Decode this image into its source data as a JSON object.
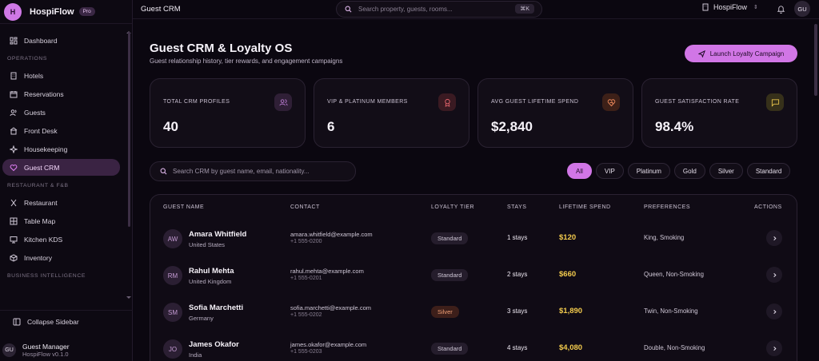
{
  "brand": {
    "logo_letter": "H",
    "name": "HospiFlow",
    "badge": "Pro"
  },
  "sidebar": {
    "top_items": [
      {
        "label": "Dashboard",
        "icon": "dashboard-icon"
      }
    ],
    "sections": [
      {
        "label": "OPERATIONS",
        "items": [
          {
            "label": "Hotels",
            "icon": "building-icon"
          },
          {
            "label": "Reservations",
            "icon": "calendar-icon"
          },
          {
            "label": "Guests",
            "icon": "users-icon"
          },
          {
            "label": "Front Desk",
            "icon": "bell-desk-icon"
          },
          {
            "label": "Housekeeping",
            "icon": "sparkle-icon"
          },
          {
            "label": "Guest CRM",
            "icon": "heart-icon",
            "active": true
          }
        ]
      },
      {
        "label": "RESTAURANT & F&B",
        "items": [
          {
            "label": "Restaurant",
            "icon": "utensils-icon"
          },
          {
            "label": "Table Map",
            "icon": "grid-icon"
          },
          {
            "label": "Kitchen KDS",
            "icon": "monitor-icon"
          },
          {
            "label": "Inventory",
            "icon": "box-icon"
          }
        ]
      },
      {
        "label": "BUSINESS INTELLIGENCE",
        "items": []
      }
    ],
    "collapse_label": "Collapse Sidebar",
    "user": {
      "initials": "GU",
      "name": "Guest Manager",
      "version": "HospiFlow v0.1.0"
    }
  },
  "topbar": {
    "title": "Guest CRM",
    "search_placeholder": "Search property, guests, rooms...",
    "shortcut": "⌘K",
    "property": "HospiFlow",
    "avatar": "GU"
  },
  "page": {
    "title": "Guest CRM & Loyalty OS",
    "subtitle": "Guest relationship history, tier rewards, and engagement campaigns",
    "launch_button": "Launch Loyalty Campaign"
  },
  "stats": [
    {
      "label": "TOTAL CRM PROFILES",
      "value": "40",
      "icon": "users-icon",
      "color": "#b97ad0",
      "bg": "#2f1f36"
    },
    {
      "label": "VIP & PLATINUM MEMBERS",
      "value": "6",
      "icon": "award-icon",
      "color": "#e0626a",
      "bg": "#3a1a22"
    },
    {
      "label": "AVG GUEST LIFETIME SPEND",
      "value": "$2,840",
      "icon": "heart-icon",
      "color": "#f08a5d",
      "bg": "#3d2018"
    },
    {
      "label": "GUEST SATISFACTION RATE",
      "value": "98.4%",
      "icon": "message-icon",
      "color": "#e3c04a",
      "bg": "#36301a"
    }
  ],
  "crm_search_placeholder": "Search CRM by guest name, email, nationality...",
  "filters": [
    "All",
    "VIP",
    "Platinum",
    "Gold",
    "Silver",
    "Standard"
  ],
  "table": {
    "headers": [
      "GUEST NAME",
      "CONTACT",
      "LOYALTY TIER",
      "STAYS",
      "LIFETIME SPEND",
      "PREFERENCES",
      "ACTIONS"
    ],
    "rows": [
      {
        "initials": "AW",
        "name": "Amara Whitfield",
        "country": "United States",
        "email": "amara.whitfield@example.com",
        "phone": "+1 555-0200",
        "tier": "Standard",
        "stays": "1 stays",
        "spend": "$120",
        "prefs": "King, Smoking"
      },
      {
        "initials": "RM",
        "name": "Rahul Mehta",
        "country": "United Kingdom",
        "email": "rahul.mehta@example.com",
        "phone": "+1 555-0201",
        "tier": "Standard",
        "stays": "2 stays",
        "spend": "$660",
        "prefs": "Queen, Non-Smoking"
      },
      {
        "initials": "SM",
        "name": "Sofia Marchetti",
        "country": "Germany",
        "email": "sofia.marchetti@example.com",
        "phone": "+1 555-0202",
        "tier": "Silver",
        "stays": "3 stays",
        "spend": "$1,890",
        "prefs": "Twin, Non-Smoking"
      },
      {
        "initials": "JO",
        "name": "James Okafor",
        "country": "India",
        "email": "james.okafor@example.com",
        "phone": "+1 555-0203",
        "tier": "Standard",
        "stays": "4 stays",
        "spend": "$4,080",
        "prefs": "Double, Non-Smoking"
      }
    ]
  }
}
